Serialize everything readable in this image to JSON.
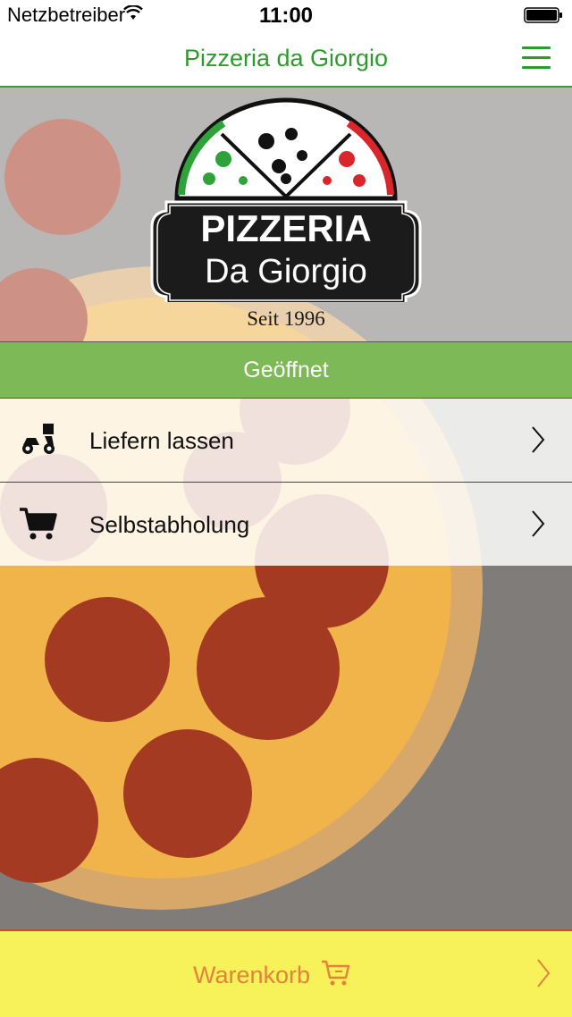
{
  "status_bar": {
    "carrier": "Netzbetreiber",
    "time": "11:00"
  },
  "nav": {
    "title": "Pizzeria da Giorgio"
  },
  "logo": {
    "line1": "PIZZERIA",
    "line2": "Da Giorgio",
    "since": "Seit 1996"
  },
  "open_status": {
    "label": "Geöffnet"
  },
  "options": [
    {
      "label": "Liefern lassen",
      "icon": "delivery-scooter-icon"
    },
    {
      "label": "Selbstabholung",
      "icon": "shopping-cart-icon"
    }
  ],
  "cart": {
    "label": "Warenkorb",
    "icon": "cart-icon"
  },
  "colors": {
    "brand_green": "#2e9a2e",
    "open_green": "#7db956",
    "cart_yellow": "#f7f25a",
    "cart_text": "#e3823a"
  }
}
